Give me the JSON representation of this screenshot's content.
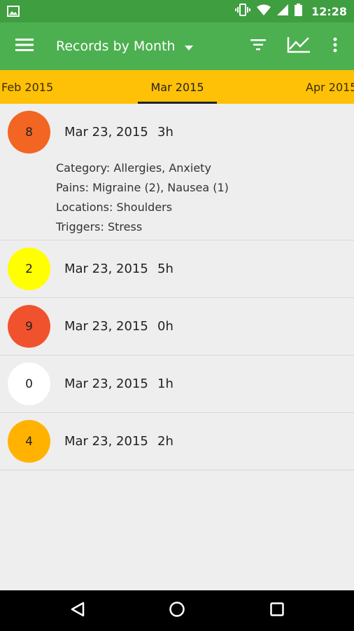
{
  "status_bar": {
    "time": "12:28",
    "icons": [
      "image-icon",
      "vibrate-icon",
      "wifi-icon",
      "signal-icon",
      "battery-icon"
    ]
  },
  "app_bar": {
    "title": "Records by Month",
    "icons": [
      "menu-icon",
      "dropdown-arrow-icon",
      "filter-icon",
      "chart-icon",
      "more-vert-icon"
    ]
  },
  "month_tabs": {
    "prev": "Feb 2015",
    "current": "Mar 2015",
    "next": "Apr 2015",
    "color": "#FFC107"
  },
  "records": [
    {
      "level": "8",
      "date": "Mar 23, 2015",
      "duration": "3h",
      "color": "#F26522",
      "details": {
        "category": "Category: Allergies, Anxiety",
        "pains": "Pains: Migraine (2), Nausea (1)",
        "locations": "Locations: Shoulders",
        "triggers": "Triggers: Stress"
      }
    },
    {
      "level": "2",
      "date": "Mar 23, 2015",
      "duration": "5h",
      "color": "#FFFF00"
    },
    {
      "level": "9",
      "date": "Mar 23, 2015",
      "duration": "0h",
      "color": "#F1522E"
    },
    {
      "level": "0",
      "date": "Mar 23, 2015",
      "duration": "1h",
      "color": "#FFFFFF"
    },
    {
      "level": "4",
      "date": "Mar 23, 2015",
      "duration": "2h",
      "color": "#FFB300"
    }
  ],
  "nav_bar": {
    "icons": [
      "back-icon",
      "home-icon",
      "recents-icon"
    ]
  }
}
